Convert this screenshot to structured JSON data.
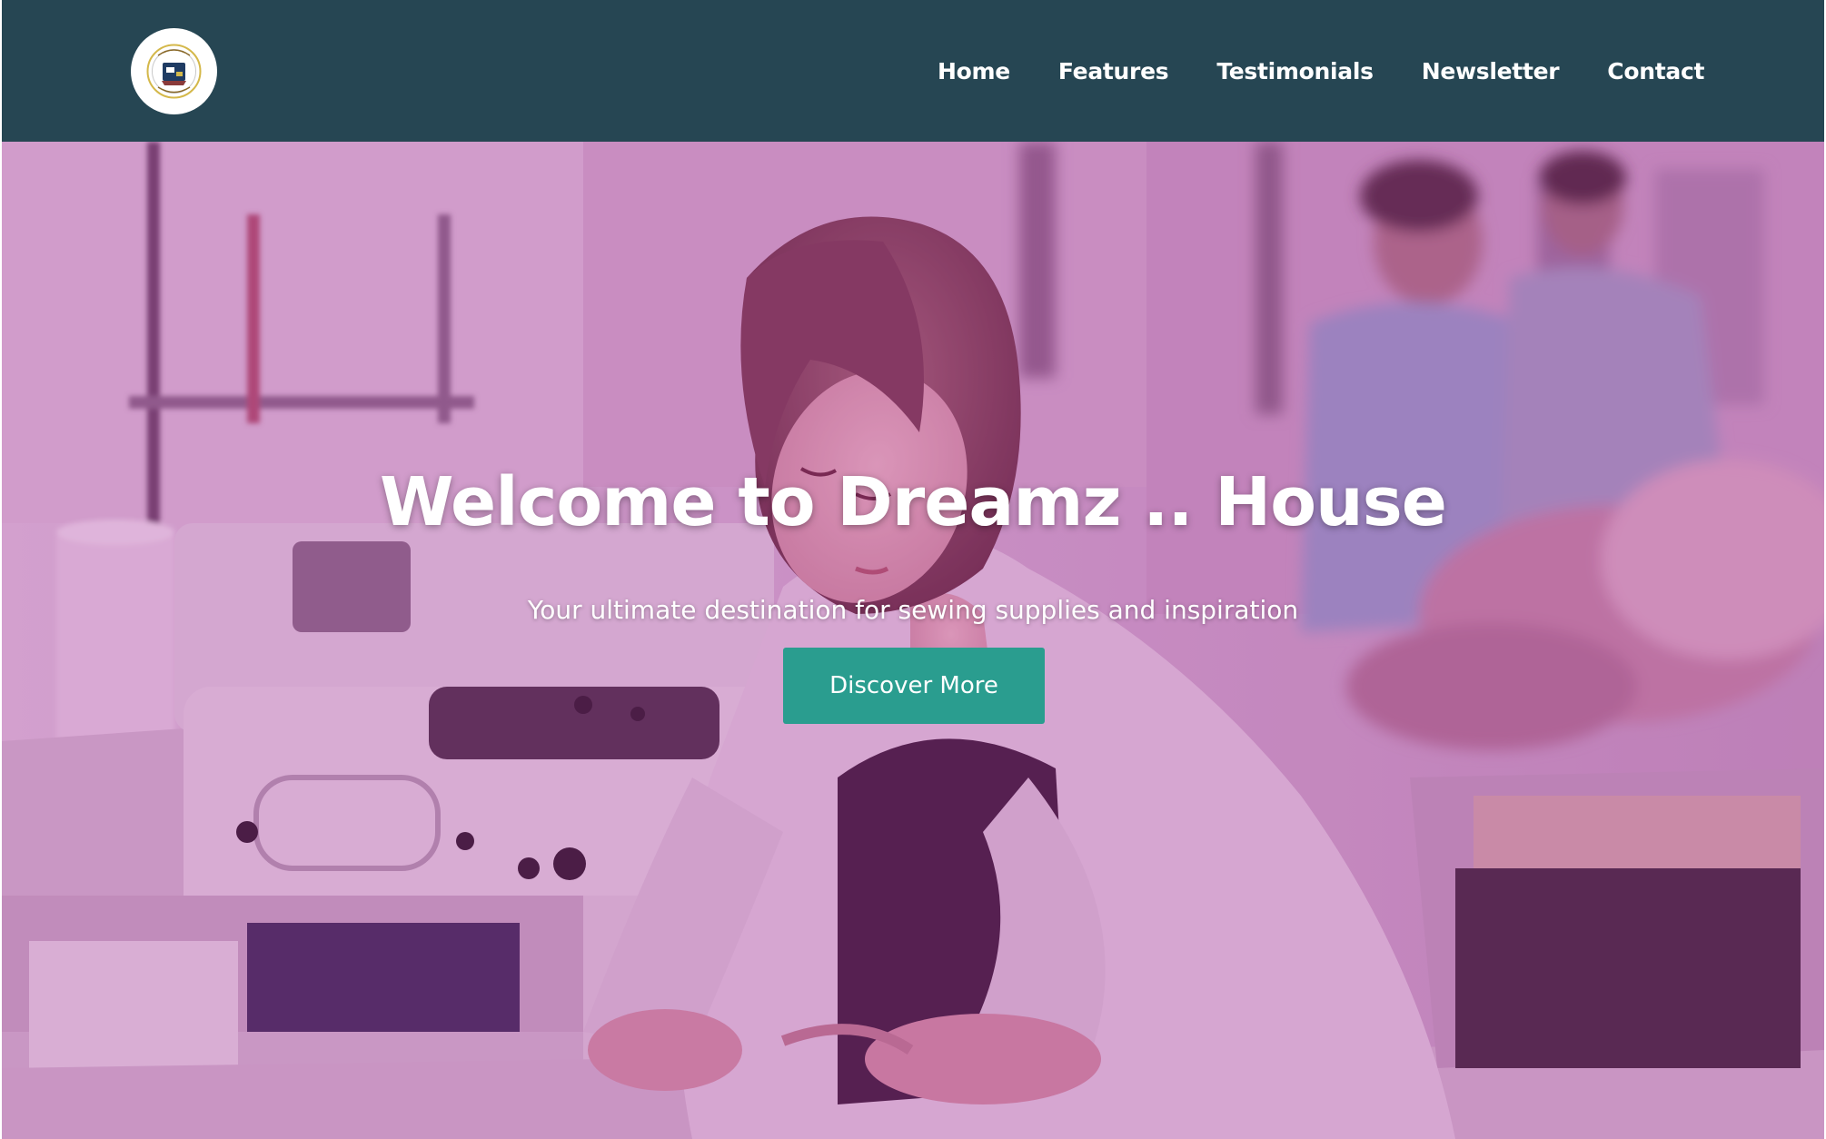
{
  "header": {
    "logo_icon": "brand-logo-badge",
    "nav_items": [
      {
        "label": "Home"
      },
      {
        "label": "Features"
      },
      {
        "label": "Testimonials"
      },
      {
        "label": "Newsletter"
      },
      {
        "label": "Contact"
      }
    ]
  },
  "hero": {
    "title": "Welcome to Dreamz .. House",
    "subtitle": "Your ultimate destination for sewing supplies and inspiration",
    "cta_label": "Discover More",
    "background_image": "woman-sewing-at-machine-photo"
  },
  "colors": {
    "navbar": "#264653",
    "accent": "#2a9d8f",
    "overlay": "#a0289680"
  }
}
